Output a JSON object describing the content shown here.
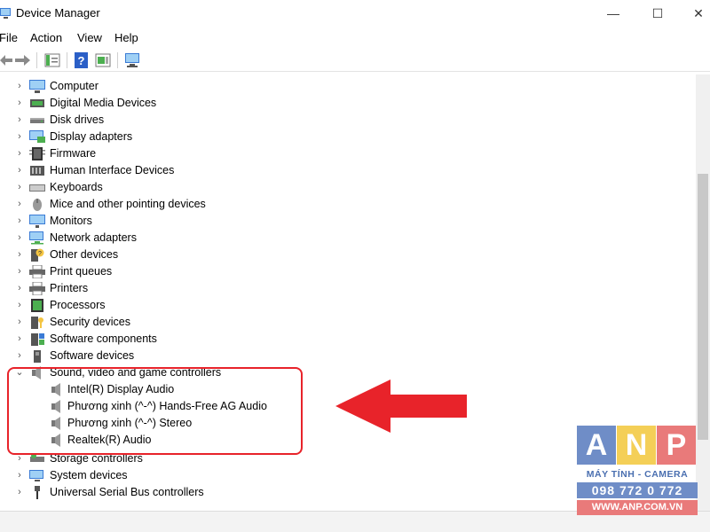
{
  "window": {
    "title": "Device Manager",
    "controls": {
      "minimize": "—",
      "maximize": "☐",
      "close": "✕"
    }
  },
  "menu": [
    "File",
    "Action",
    "View",
    "Help"
  ],
  "toolbar": [
    "back-arrow-icon",
    "forward-arrow-icon",
    "properties-icon",
    "help-icon",
    "update-driver-icon",
    "scan-hardware-icon"
  ],
  "tree": {
    "items": [
      {
        "label": "Computer",
        "expanded": false,
        "icon": "computer-icon"
      },
      {
        "label": "Digital Media Devices",
        "expanded": false,
        "icon": "media-device-icon"
      },
      {
        "label": "Disk drives",
        "expanded": false,
        "icon": "disk-drive-icon"
      },
      {
        "label": "Display adapters",
        "expanded": false,
        "icon": "display-adapter-icon"
      },
      {
        "label": "Firmware",
        "expanded": false,
        "icon": "firmware-icon"
      },
      {
        "label": "Human Interface Devices",
        "expanded": false,
        "icon": "hid-icon"
      },
      {
        "label": "Keyboards",
        "expanded": false,
        "icon": "keyboard-icon"
      },
      {
        "label": "Mice and other pointing devices",
        "expanded": false,
        "icon": "mouse-icon"
      },
      {
        "label": "Monitors",
        "expanded": false,
        "icon": "monitor-icon"
      },
      {
        "label": "Network adapters",
        "expanded": false,
        "icon": "network-adapter-icon"
      },
      {
        "label": "Other devices",
        "expanded": false,
        "icon": "other-devices-icon"
      },
      {
        "label": "Print queues",
        "expanded": false,
        "icon": "print-queue-icon"
      },
      {
        "label": "Printers",
        "expanded": false,
        "icon": "printer-icon"
      },
      {
        "label": "Processors",
        "expanded": false,
        "icon": "processor-icon"
      },
      {
        "label": "Security devices",
        "expanded": false,
        "icon": "security-device-icon"
      },
      {
        "label": "Software components",
        "expanded": false,
        "icon": "software-component-icon"
      },
      {
        "label": "Software devices",
        "expanded": false,
        "icon": "software-device-icon"
      },
      {
        "label": "Sound, video and game controllers",
        "expanded": true,
        "icon": "speaker-icon"
      },
      {
        "label": "Storage controllers",
        "expanded": false,
        "icon": "storage-controller-icon"
      },
      {
        "label": "System devices",
        "expanded": false,
        "icon": "system-device-icon"
      },
      {
        "label": "Universal Serial Bus controllers",
        "expanded": false,
        "icon": "usb-icon"
      }
    ],
    "sound_children": [
      "Intel(R) Display Audio",
      "Phương xinh (^-^) Hands-Free AG Audio",
      "Phương xinh (^-^) Stereo",
      "Realtek(R) Audio"
    ]
  },
  "colors": {
    "highlight": "#e8232a",
    "arrow": "#e8232a",
    "logo_blue": "#6f8dc7",
    "logo_yellow": "#f4cf57",
    "logo_red": "#e97a7a"
  },
  "logo": {
    "letters": [
      "A",
      "N",
      "P"
    ],
    "tagline": "MÁY TÍNH - CAMERA",
    "phone": "098 772 0 772",
    "website": "WWW.ANP.COM.VN"
  }
}
